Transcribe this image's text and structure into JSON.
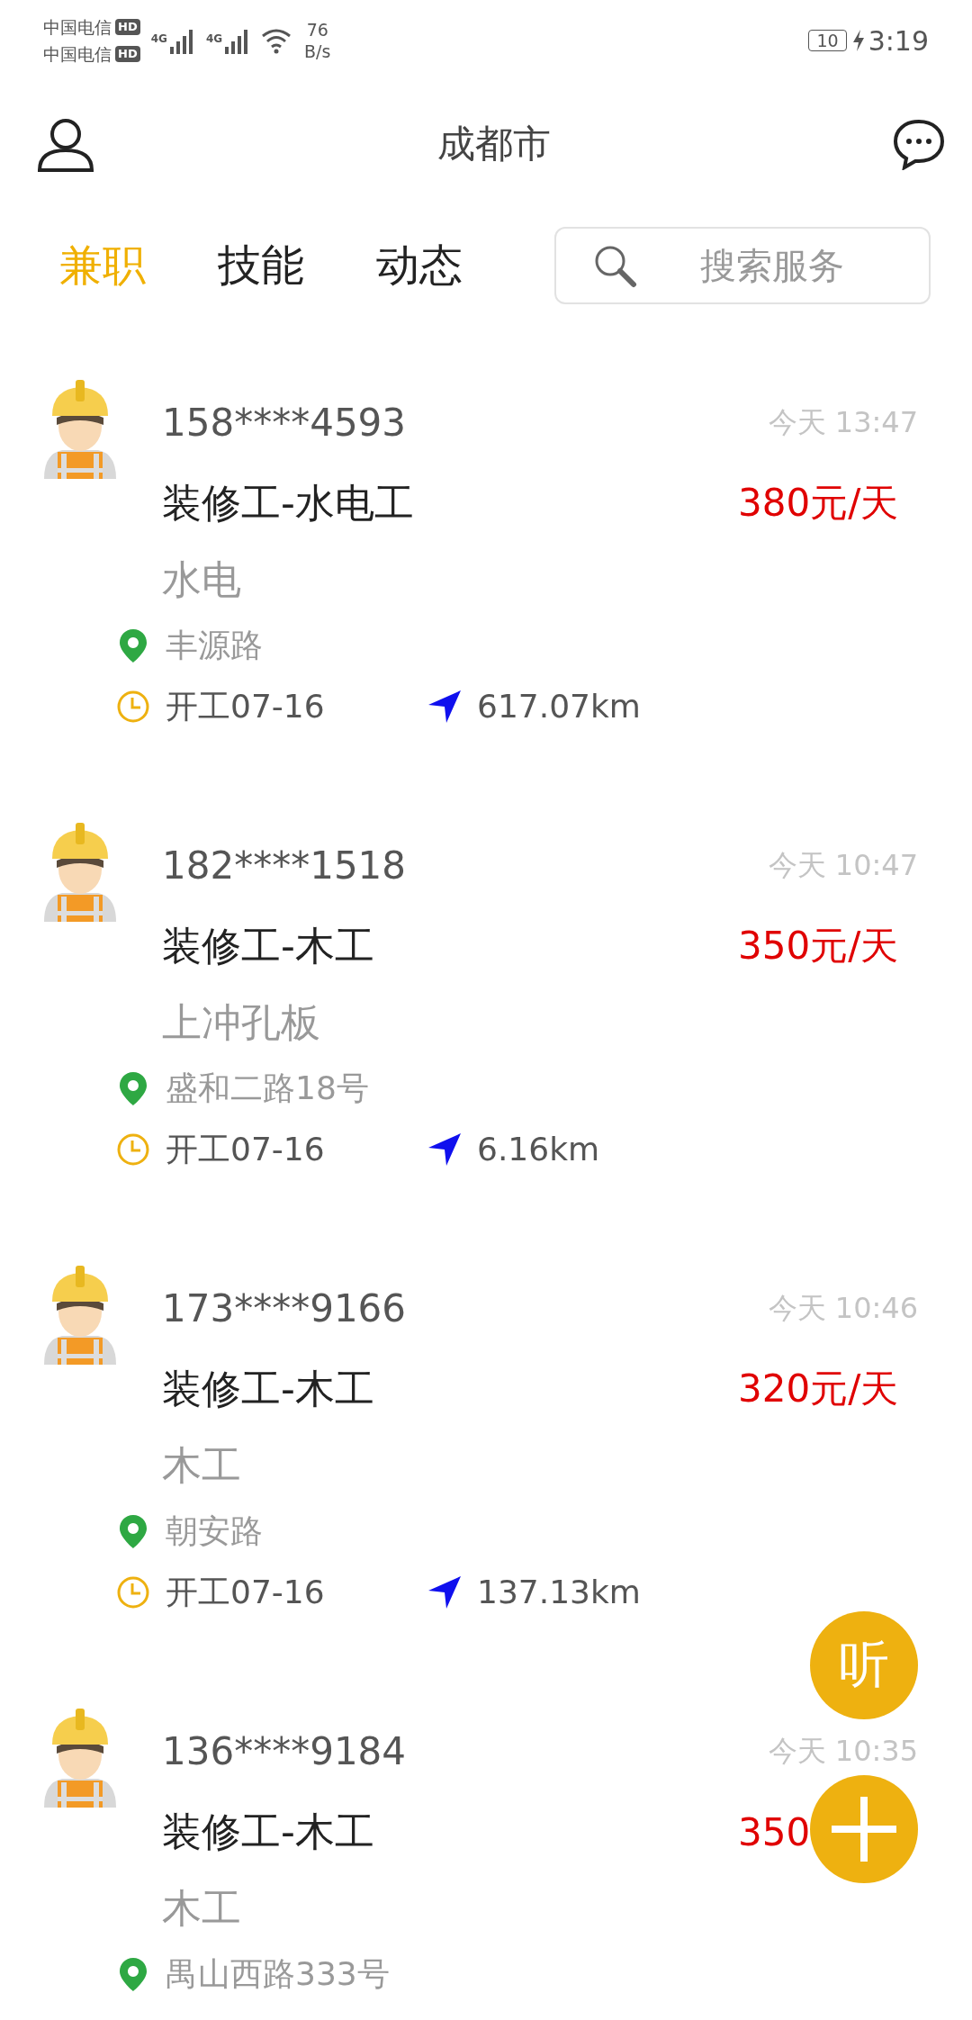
{
  "status_bar": {
    "carrier_1": "中国电信",
    "carrier_2": "中国电信",
    "hd_1": "HD",
    "hd_2": "HD",
    "net_1": "4G",
    "net_2": "4G",
    "speed_value": "76",
    "speed_unit": "B/s",
    "battery": "10",
    "time": "3:19"
  },
  "header": {
    "title": "成都市"
  },
  "tabs": [
    {
      "label": "兼职",
      "selected": true
    },
    {
      "label": "技能",
      "selected": false
    },
    {
      "label": "动态",
      "selected": false
    }
  ],
  "search": {
    "placeholder": "搜索服务"
  },
  "jobs": [
    {
      "phone": "158****4593",
      "time": "今天 13:47",
      "title": "装修工-水电工",
      "price": "380元/天",
      "subtitle": "水电",
      "location": "丰源路",
      "start": "开工07-16",
      "distance": "617.07km"
    },
    {
      "phone": "182****1518",
      "time": "今天 10:47",
      "title": "装修工-木工",
      "price": "350元/天",
      "subtitle": "上冲孔板",
      "location": "盛和二路18号",
      "start": "开工07-16",
      "distance": "6.16km"
    },
    {
      "phone": "173****9166",
      "time": "今天 10:46",
      "title": "装修工-木工",
      "price": "320元/天",
      "subtitle": "木工",
      "location": "朝安路",
      "start": "开工07-16",
      "distance": "137.13km"
    },
    {
      "phone": "136****9184",
      "time": "今天 10:35",
      "title": "装修工-木工",
      "price": "350",
      "subtitle": "木工",
      "location": "禺山西路333号"
    }
  ],
  "fab_listen": {
    "label": "听"
  }
}
